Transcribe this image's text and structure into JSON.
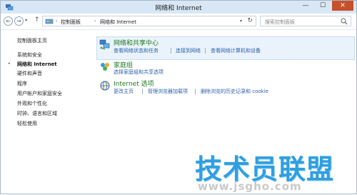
{
  "window": {
    "title": "网络和 Internet"
  },
  "caption_buttons": {
    "minimize": "—",
    "maximize": "☐",
    "close": "✕"
  },
  "nav": {
    "back": "←",
    "forward": "→",
    "dropdown": "▾",
    "up": "↑"
  },
  "address": {
    "crumbs": [
      "控制面板",
      "网络和 Internet"
    ],
    "separator": "›",
    "dropdown": "▾",
    "refresh": "↻"
  },
  "search": {
    "placeholder": "搜索控制面板"
  },
  "sidebar": {
    "items": [
      {
        "label": "控制面板主页",
        "current": false
      },
      {
        "label": "系统和安全",
        "current": false
      },
      {
        "label": "网络和 Internet",
        "current": true
      },
      {
        "label": "硬件和声音",
        "current": false
      },
      {
        "label": "程序",
        "current": false
      },
      {
        "label": "用户帐户和家庭安全",
        "current": false
      },
      {
        "label": "外观和个性化",
        "current": false
      },
      {
        "label": "时钟、语言和区域",
        "current": false
      },
      {
        "label": "轻松使用",
        "current": false
      }
    ],
    "bullet": "•"
  },
  "sections": [
    {
      "title": "网络和共享中心",
      "links": [
        "查看网络状态和任务",
        "连接到网络",
        "查看网络计算机和设备"
      ]
    },
    {
      "title": "家庭组",
      "links": [
        "选择家庭组和共享选项"
      ]
    },
    {
      "title": "Internet 选项",
      "links": [
        "更改主页",
        "管理浏览器加载项",
        "删除浏览的历史记录和 cookie"
      ]
    }
  ],
  "watermark": {
    "text": "技术员联盟",
    "url": "www.jsgho.com"
  },
  "colors": {
    "section_title": "#1f7a1f",
    "link": "#2b5fa8",
    "highlight": "#eaf3fb",
    "watermark": "#2f9fe0"
  }
}
